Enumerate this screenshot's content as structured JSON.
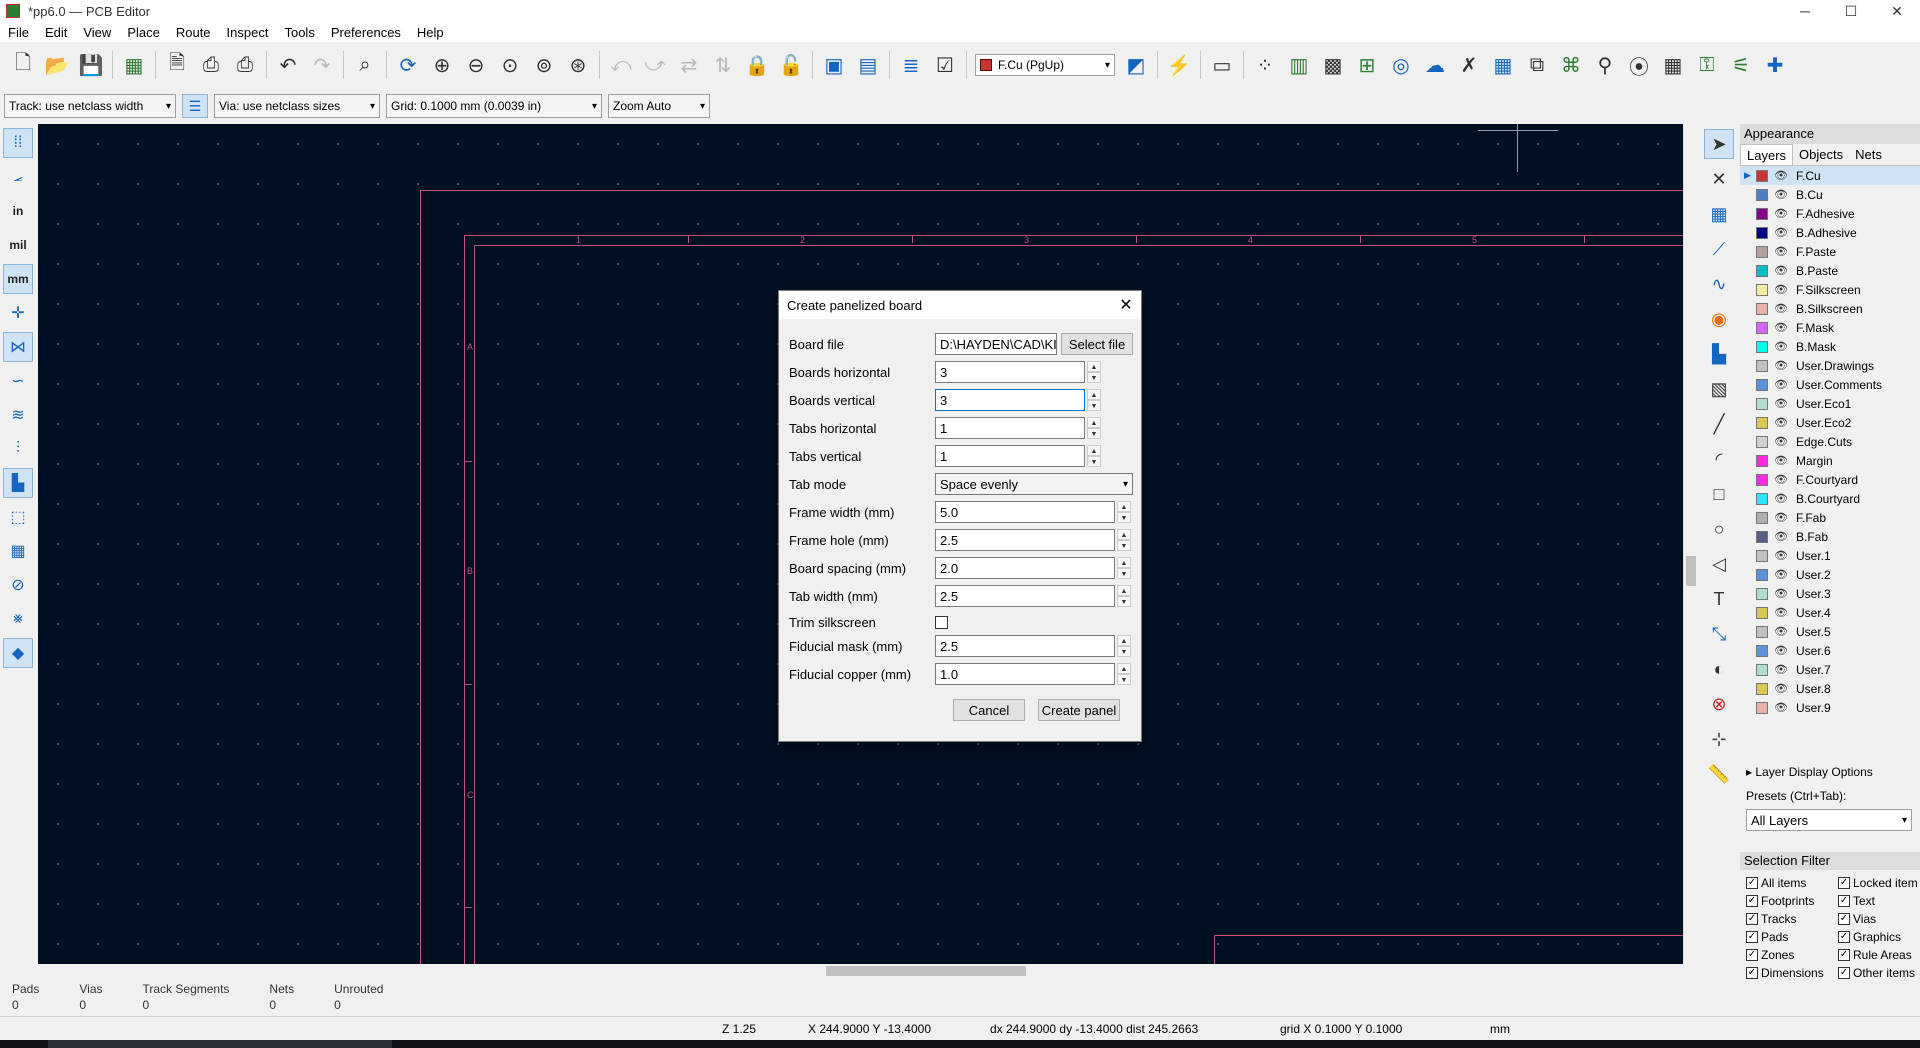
{
  "window": {
    "title": "*pp6.0 — PCB Editor",
    "minimize": "─",
    "maximize": "☐",
    "close": "✕"
  },
  "menu": [
    "File",
    "Edit",
    "View",
    "Place",
    "Route",
    "Inspect",
    "Tools",
    "Preferences",
    "Help"
  ],
  "toolbar": {
    "layer_select": "F.Cu (PgUp)",
    "layer_color": "#c83434"
  },
  "aux": {
    "track": "Track: use netclass width",
    "via": "Via: use netclass sizes",
    "grid": "Grid: 0.1000 mm (0.0039 in)",
    "zoom": "Zoom Auto"
  },
  "left_toolbar": {
    "in_label": "in",
    "mil_label": "mil",
    "mm_label": "mm"
  },
  "canvas": {
    "frame_cols": [
      "1",
      "2",
      "3",
      "4",
      "5"
    ],
    "frame_rows": [
      "A",
      "B",
      "C"
    ]
  },
  "dialog": {
    "title": "Create panelized board",
    "close": "✕",
    "board_file_label": "Board file",
    "board_file_value": "D:\\HAYDEN\\CAD\\KI",
    "select_file": "Select file",
    "fields": [
      {
        "label": "Boards horizontal",
        "value": "3"
      },
      {
        "label": "Boards vertical",
        "value": "3"
      },
      {
        "label": "Tabs horizontal",
        "value": "1"
      },
      {
        "label": "Tabs vertical",
        "value": "1"
      }
    ],
    "tab_mode_label": "Tab mode",
    "tab_mode_value": "Space evenly",
    "fields2": [
      {
        "label": "Frame width (mm)",
        "value": "5.0"
      },
      {
        "label": "Frame hole (mm)",
        "value": "2.5"
      },
      {
        "label": "Board spacing (mm)",
        "value": "2.0"
      },
      {
        "label": "Tab width (mm)",
        "value": "2.5"
      }
    ],
    "trim_label": "Trim silkscreen",
    "trim_checked": false,
    "fields3": [
      {
        "label": "Fiducial mask (mm)",
        "value": "2.5"
      },
      {
        "label": "Fiducial copper (mm)",
        "value": "1.0"
      }
    ],
    "cancel": "Cancel",
    "create": "Create panel"
  },
  "appearance": {
    "title": "Appearance",
    "tabs": [
      "Layers",
      "Objects",
      "Nets"
    ],
    "layers": [
      {
        "name": "F.Cu",
        "color": "#c83434"
      },
      {
        "name": "B.Cu",
        "color": "#4d7fc4"
      },
      {
        "name": "F.Adhesive",
        "color": "#84008a"
      },
      {
        "name": "B.Adhesive",
        "color": "#000084"
      },
      {
        "name": "F.Paste",
        "color": "#b4a09e"
      },
      {
        "name": "B.Paste",
        "color": "#00c2c2"
      },
      {
        "name": "F.Silkscreen",
        "color": "#f2eda1"
      },
      {
        "name": "B.Silkscreen",
        "color": "#e8b2a7"
      },
      {
        "name": "F.Mask",
        "color": "#d864ff"
      },
      {
        "name": "B.Mask",
        "color": "#02ffee"
      },
      {
        "name": "User.Drawings",
        "color": "#c2c2c2"
      },
      {
        "name": "User.Comments",
        "color": "#5994dc"
      },
      {
        "name": "User.Eco1",
        "color": "#b4dbd2"
      },
      {
        "name": "User.Eco2",
        "color": "#d8c852"
      },
      {
        "name": "Edge.Cuts",
        "color": "#d0d2cd"
      },
      {
        "name": "Margin",
        "color": "#ff26e2"
      },
      {
        "name": "F.Courtyard",
        "color": "#ff26e2"
      },
      {
        "name": "B.Courtyard",
        "color": "#26e9ff"
      },
      {
        "name": "F.Fab",
        "color": "#afafaf"
      },
      {
        "name": "B.Fab",
        "color": "#585d84"
      },
      {
        "name": "User.1",
        "color": "#c2c2c2"
      },
      {
        "name": "User.2",
        "color": "#5994dc"
      },
      {
        "name": "User.3",
        "color": "#b4dbd2"
      },
      {
        "name": "User.4",
        "color": "#d8c852"
      },
      {
        "name": "User.5",
        "color": "#c2c2c2"
      },
      {
        "name": "User.6",
        "color": "#5994dc"
      },
      {
        "name": "User.7",
        "color": "#b4dbd2"
      },
      {
        "name": "User.8",
        "color": "#d8c852"
      },
      {
        "name": "User.9",
        "color": "#e8b2a7"
      }
    ],
    "layer_display_options": "Layer Display Options",
    "presets_label": "Presets (Ctrl+Tab):",
    "presets_value": "All Layers"
  },
  "selection_filter": {
    "title": "Selection Filter",
    "items": [
      "All items",
      "Locked item",
      "Footprints",
      "Text",
      "Tracks",
      "Vias",
      "Pads",
      "Graphics",
      "Zones",
      "Rule Areas",
      "Dimensions",
      "Other items"
    ]
  },
  "messages": [
    {
      "label": "Pads",
      "value": "0"
    },
    {
      "label": "Vias",
      "value": "0"
    },
    {
      "label": "Track Segments",
      "value": "0"
    },
    {
      "label": "Nets",
      "value": "0"
    },
    {
      "label": "Unrouted",
      "value": "0"
    }
  ],
  "status": {
    "zoom": "Z 1.25",
    "xy": "X 244.9000  Y -13.4000",
    "delta": "dx 244.9000  dy -13.4000  dist 245.2663",
    "grid": "grid X 0.1000  Y 0.1000",
    "units": "mm"
  }
}
